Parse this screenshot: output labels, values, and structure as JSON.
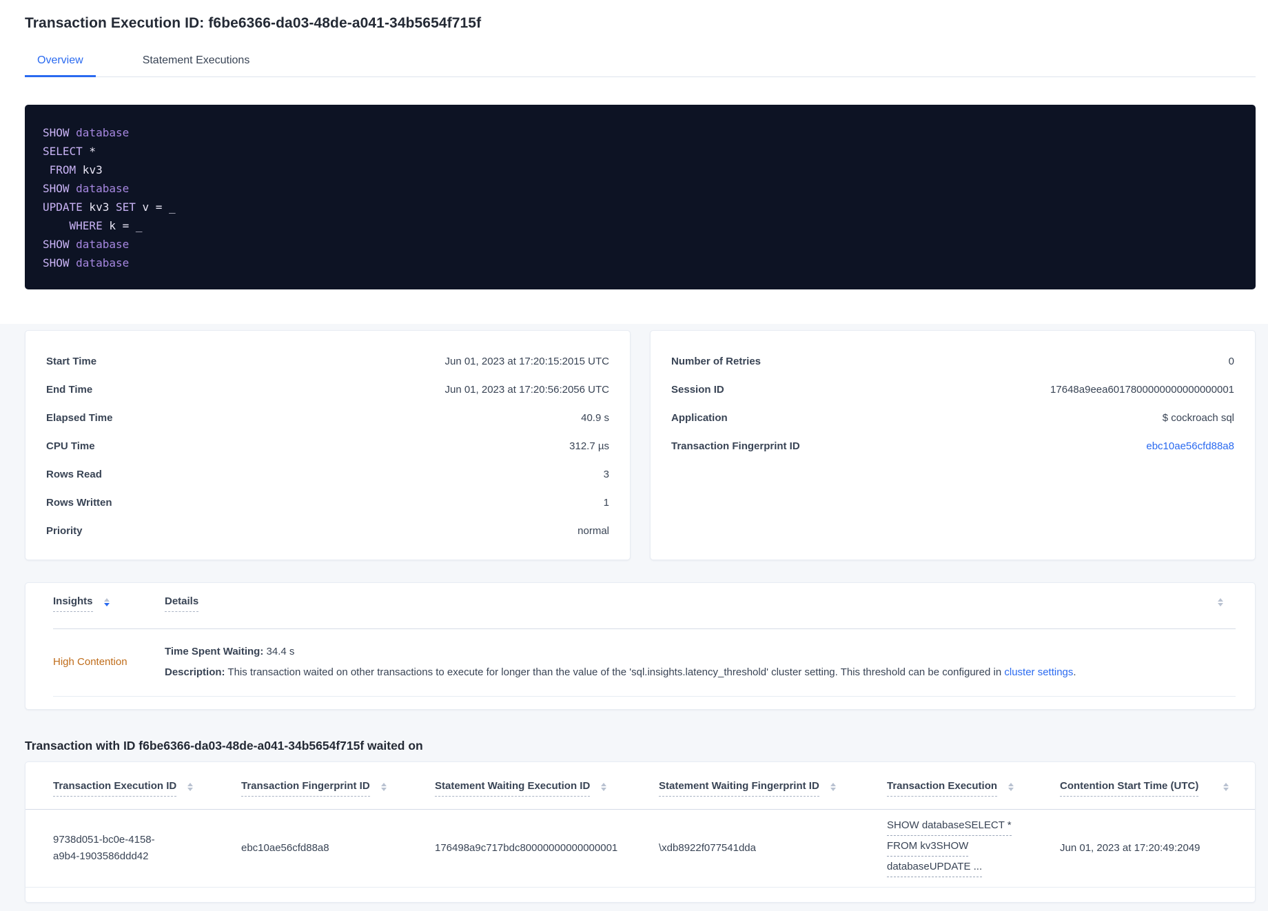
{
  "page_title": "Transaction Execution ID: f6be6366-da03-48de-a041-34b5654f715f",
  "tabs": {
    "overview": "Overview",
    "statement_executions": "Statement Executions"
  },
  "sql_lines": [
    {
      "tokens": [
        {
          "c": "kw",
          "t": "SHOW"
        },
        {
          "c": "id",
          "t": " "
        },
        {
          "c": "db",
          "t": "database"
        }
      ]
    },
    {
      "tokens": [
        {
          "c": "kw",
          "t": "SELECT"
        },
        {
          "c": "id",
          "t": " *"
        }
      ]
    },
    {
      "tokens": [
        {
          "c": "id",
          "t": " "
        },
        {
          "c": "kw",
          "t": "FROM"
        },
        {
          "c": "id",
          "t": " kv3"
        }
      ]
    },
    {
      "tokens": [
        {
          "c": "kw",
          "t": "SHOW"
        },
        {
          "c": "id",
          "t": " "
        },
        {
          "c": "db",
          "t": "database"
        }
      ]
    },
    {
      "tokens": [
        {
          "c": "kw",
          "t": "UPDATE"
        },
        {
          "c": "id",
          "t": " kv3 "
        },
        {
          "c": "kw",
          "t": "SET"
        },
        {
          "c": "id",
          "t": " v = _"
        }
      ]
    },
    {
      "tokens": [
        {
          "c": "id",
          "t": "    "
        },
        {
          "c": "kw",
          "t": "WHERE"
        },
        {
          "c": "id",
          "t": " k = _"
        }
      ]
    },
    {
      "tokens": [
        {
          "c": "kw",
          "t": "SHOW"
        },
        {
          "c": "id",
          "t": " "
        },
        {
          "c": "db",
          "t": "database"
        }
      ]
    },
    {
      "tokens": [
        {
          "c": "kw",
          "t": "SHOW"
        },
        {
          "c": "id",
          "t": " "
        },
        {
          "c": "db",
          "t": "database"
        }
      ]
    }
  ],
  "summary_left": {
    "rows": [
      {
        "label": "Start Time",
        "value": "Jun 01, 2023 at 17:20:15:2015 UTC"
      },
      {
        "label": "End Time",
        "value": "Jun 01, 2023 at 17:20:56:2056 UTC"
      },
      {
        "label": "Elapsed Time",
        "value": "40.9 s"
      },
      {
        "label": "CPU Time",
        "value": "312.7 µs"
      },
      {
        "label": "Rows Read",
        "value": "3"
      },
      {
        "label": "Rows Written",
        "value": "1"
      },
      {
        "label": "Priority",
        "value": "normal"
      }
    ]
  },
  "summary_right": {
    "rows": [
      {
        "label": "Number of Retries",
        "value": "0"
      },
      {
        "label": "Session ID",
        "value": "17648a9eea6017800000000000000001"
      },
      {
        "label": "Application",
        "value": "$ cockroach sql"
      }
    ],
    "fingerprint_label": "Transaction Fingerprint ID",
    "fingerprint_value": "ebc10ae56cfd88a8"
  },
  "insights": {
    "col_insights": "Insights",
    "col_details": "Details",
    "row": {
      "insight": "High Contention",
      "waiting_label": "Time Spent Waiting:",
      "waiting_value": " 34.4 s",
      "description_label": "Description:",
      "description_text": " This transaction waited on other transactions to execute for longer than the value of the 'sql.insights.latency_threshold' cluster setting. This threshold can be configured in ",
      "description_link": "cluster settings",
      "description_end": "."
    }
  },
  "waited_on": {
    "heading": "Transaction with ID f6be6366-da03-48de-a041-34b5654f715f waited on",
    "columns": [
      "Transaction Execution ID",
      "Transaction Fingerprint ID",
      "Statement Waiting Execution ID",
      "Statement Waiting Fingerprint ID",
      "Transaction Execution",
      "Contention Start Time (UTC)"
    ],
    "row": {
      "transaction_execution_id": "9738d051-bc0e-4158-a9b4-1903586ddd42",
      "transaction_fingerprint_id": "ebc10ae56cfd88a8",
      "statement_waiting_execution_id": "176498a9c717bdc80000000000000001",
      "statement_waiting_fingerprint_id": "\\xdb8922f077541dda",
      "transaction_execution_lines": [
        "SHOW databaseSELECT *",
        "FROM kv3SHOW",
        "databaseUPDATE ..."
      ],
      "contention_start_time": "Jun 01, 2023 at 17:20:49:2049"
    }
  },
  "colors": {
    "accent_blue": "#2a6af0",
    "insight_orange": "#bf6c1a",
    "code_background": "#0d1324",
    "code_keyword": "#c9b3f5",
    "code_secondary": "#a687e0",
    "code_plain": "#e9e6f5",
    "section_background": "#f5f7fa"
  }
}
